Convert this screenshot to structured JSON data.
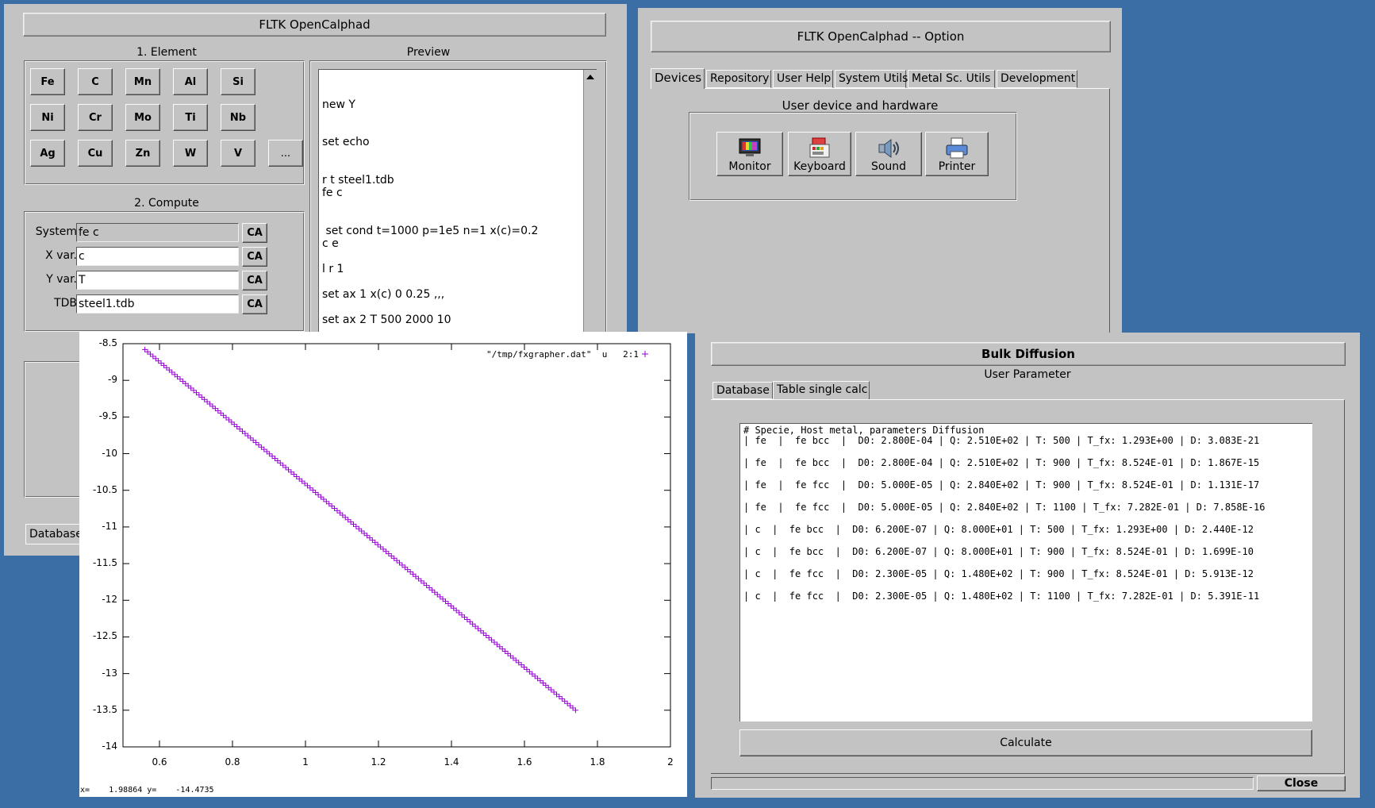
{
  "main_window": {
    "title": "FLTK OpenCalphad",
    "element_group_label": "1. Element",
    "elements": [
      "Fe",
      "C",
      "Mn",
      "Al",
      "Si",
      "Ni",
      "Cr",
      "Mo",
      "Ti",
      "Nb",
      "Ag",
      "Cu",
      "Zn",
      "W",
      "V",
      "..."
    ],
    "compute_group_label": "2. Compute",
    "fields": {
      "system": {
        "label": "System",
        "value": "fe c",
        "button": "CA"
      },
      "xvar": {
        "label": "X var.",
        "value": "c",
        "button": "CA"
      },
      "yvar": {
        "label": "Y var.",
        "value": "T",
        "button": "CA"
      },
      "tdb": {
        "label": "TDB",
        "value": "steel1.tdb",
        "button": "CA"
      }
    },
    "preview_label": "Preview",
    "preview_lines": [
      "new Y",
      "set echo",
      "r t steel1.tdb",
      "fe c",
      " set cond t=1000 p=1e5 n=1 x(c)=0.2",
      "c e",
      "l r 1",
      "set ax 1 x(c) 0 0.25 ,,,",
      "set ax 2 T 500 2000 10"
    ],
    "database_tab_fragment": "Database"
  },
  "option_window": {
    "title": "FLTK OpenCalphad -- Option",
    "tabs": [
      "Devices",
      "Repository",
      "User Help",
      "System Utils",
      "Metal Sc. Utils",
      "Development"
    ],
    "active_tab": "Devices",
    "group_label": "User device and hardware",
    "devices": [
      {
        "label": "Monitor",
        "icon": "monitor-icon"
      },
      {
        "label": "Keyboard",
        "icon": "keyboard-icon"
      },
      {
        "label": "Sound",
        "icon": "speaker-icon"
      },
      {
        "label": "Printer",
        "icon": "printer-icon"
      }
    ]
  },
  "plot_window": {
    "legend": "\"/tmp/fxgrapher.dat\"  u   2:1",
    "status": "x=    1.98864 y=    -14.4735",
    "point_color": "#9400d3"
  },
  "chart_data": {
    "type": "scatter",
    "x_ticks": [
      "0.6",
      "0.8",
      "1",
      "1.2",
      "1.4",
      "1.6",
      "1.8",
      "2"
    ],
    "y_ticks": [
      "-8.5",
      "-9",
      "-9.5",
      "-10",
      "-10.5",
      "-11",
      "-11.5",
      "-12",
      "-12.5",
      "-13",
      "-13.5",
      "-14"
    ],
    "xlim": [
      0.5,
      2.0
    ],
    "ylim": [
      -14,
      -8.5
    ],
    "series": [
      {
        "name": "\"/tmp/fxgrapher.dat\" u 2:1",
        "x_start": 0.56,
        "x_end": 1.74,
        "y_start": -8.58,
        "y_end": -13.5,
        "marker": "+"
      }
    ],
    "grid": false,
    "legend_position": "top-right"
  },
  "diffusion_window": {
    "title": "Bulk Diffusion",
    "subtitle": "User Parameter",
    "tabs": [
      "Database",
      "Table single calc"
    ],
    "active_tab": "Table single calc",
    "table_header": "# Specie, Host metal, parameters Diffusion",
    "table_rows": [
      "| fe  |  fe bcc  |  D0: 2.800E-04 | Q: 2.510E+02 | T: 500 | T_fx: 1.293E+00 | D: 3.083E-21",
      "| fe  |  fe bcc  |  D0: 2.800E-04 | Q: 2.510E+02 | T: 900 | T_fx: 8.524E-01 | D: 1.867E-15",
      "| fe  |  fe fcc  |  D0: 5.000E-05 | Q: 2.840E+02 | T: 900 | T_fx: 8.524E-01 | D: 1.131E-17",
      "| fe  |  fe fcc  |  D0: 5.000E-05 | Q: 2.840E+02 | T: 1100 | T_fx: 7.282E-01 | D: 7.858E-16",
      "| c  |  fe bcc  |  D0: 6.200E-07 | Q: 8.000E+01 | T: 500 | T_fx: 1.293E+00 | D: 2.440E-12",
      "| c  |  fe bcc  |  D0: 6.200E-07 | Q: 8.000E+01 | T: 900 | T_fx: 8.524E-01 | D: 1.699E-10",
      "| c  |  fe fcc  |  D0: 2.300E-05 | Q: 1.480E+02 | T: 900 | T_fx: 8.524E-01 | D: 5.913E-12",
      "| c  |  fe fcc  |  D0: 2.300E-05 | Q: 1.480E+02 | T: 1100 | T_fx: 7.282E-01 | D: 5.391E-11"
    ],
    "calculate_label": "Calculate",
    "close_label": "Close"
  }
}
